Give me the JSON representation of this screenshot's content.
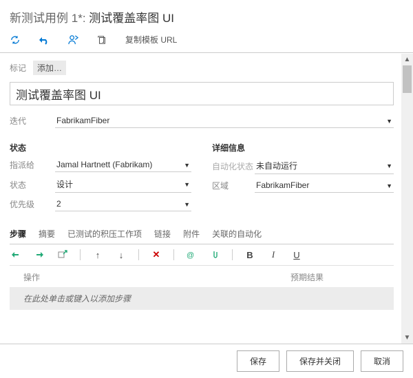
{
  "header": {
    "prefix": "新测试用例 1",
    "asterisk": "*",
    "sep": ": ",
    "title": "测试覆盖率图 UI"
  },
  "toolbar": {
    "copy_url": "复制模板 URL"
  },
  "tags": {
    "label": "标记",
    "add": "添加…"
  },
  "title_input": "测试覆盖率图 UI",
  "iteration": {
    "label": "迭代",
    "value": "FabrikamFiber"
  },
  "sectionLeft": "状态",
  "sectionRight": "详细信息",
  "left": {
    "assigned_label": "指派给",
    "assigned_value": "Jamal Hartnett (Fabrikam)",
    "state_label": "状态",
    "state_value": "设计",
    "priority_label": "优先级",
    "priority_value": "2"
  },
  "right": {
    "automation_label": "自动化状态",
    "automation_value": "未自动运行",
    "area_label": "区域",
    "area_value": "FabrikamFiber"
  },
  "tabs": [
    "步骤",
    "摘要",
    "已测试的积压工作项",
    "链接",
    "附件",
    "关联的自动化"
  ],
  "steps": {
    "col_action": "操作",
    "col_expected": "预期结果",
    "placeholder": "在此处单击或键入以添加步骤"
  },
  "footer": {
    "save": "保存",
    "save_close": "保存并关闭",
    "cancel": "取消"
  }
}
